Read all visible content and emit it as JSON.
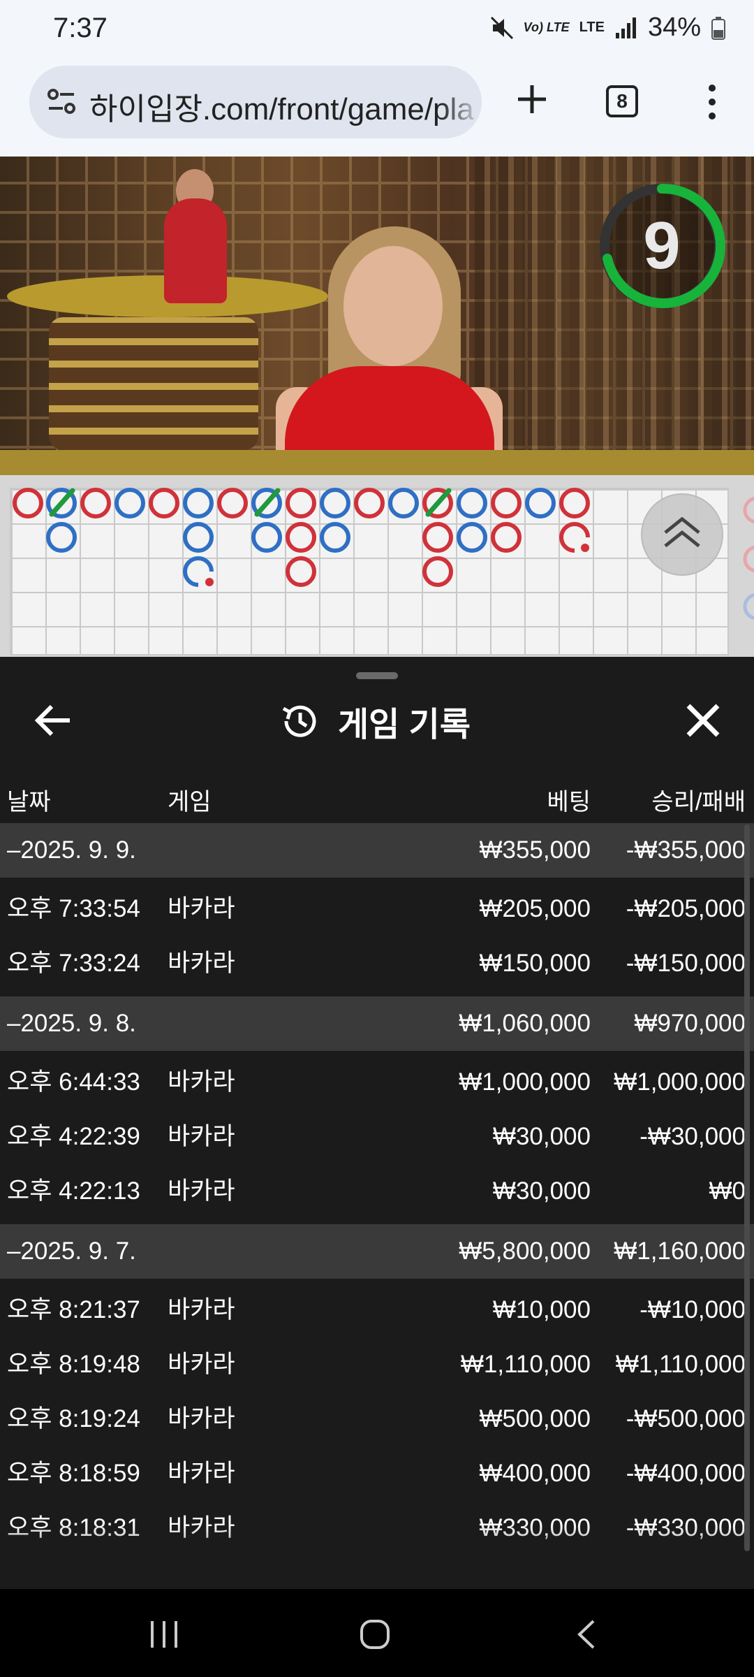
{
  "status": {
    "time": "7:37",
    "battery": "34%",
    "volte": "Vo) LTE",
    "lte": "LTE"
  },
  "browser": {
    "url": "하이입장.com/front/game/pla",
    "tab_count": "8"
  },
  "video": {
    "countdown": "9"
  },
  "sheet": {
    "title": "게임 기록",
    "headers": {
      "date": "날짜",
      "game": "게임",
      "bet": "베팅",
      "result": "승리/패배"
    },
    "groups": [
      {
        "date": "–2025. 9. 9.",
        "total_bet": "₩355,000",
        "total_result": "-₩355,000",
        "items": [
          {
            "time": "오후 7:33:54",
            "game": "바카라",
            "bet": "₩205,000",
            "result": "-₩205,000"
          },
          {
            "time": "오후 7:33:24",
            "game": "바카라",
            "bet": "₩150,000",
            "result": "-₩150,000"
          }
        ]
      },
      {
        "date": "–2025. 9. 8.",
        "total_bet": "₩1,060,000",
        "total_result": "₩970,000",
        "items": [
          {
            "time": "오후 6:44:33",
            "game": "바카라",
            "bet": "₩1,000,000",
            "result": "₩1,000,000"
          },
          {
            "time": "오후 4:22:39",
            "game": "바카라",
            "bet": "₩30,000",
            "result": "-₩30,000"
          },
          {
            "time": "오후 4:22:13",
            "game": "바카라",
            "bet": "₩30,000",
            "result": "₩0"
          }
        ]
      },
      {
        "date": "–2025. 9. 7.",
        "total_bet": "₩5,800,000",
        "total_result": "₩1,160,000",
        "items": [
          {
            "time": "오후 8:21:37",
            "game": "바카라",
            "bet": "₩10,000",
            "result": "-₩10,000"
          },
          {
            "time": "오후 8:19:48",
            "game": "바카라",
            "bet": "₩1,110,000",
            "result": "₩1,110,000"
          },
          {
            "time": "오후 8:19:24",
            "game": "바카라",
            "bet": "₩500,000",
            "result": "-₩500,000"
          },
          {
            "time": "오후 8:18:59",
            "game": "바카라",
            "bet": "₩400,000",
            "result": "-₩400,000"
          },
          {
            "time": "오후 8:18:31",
            "game": "바카라",
            "bet": "₩330,000",
            "result": "-₩330,000"
          }
        ]
      }
    ]
  },
  "colors": {
    "banker_red": "#d0323a",
    "player_blue": "#2f6fc4",
    "tie_green": "#1f9a3c",
    "timer_green": "#18b33b"
  }
}
